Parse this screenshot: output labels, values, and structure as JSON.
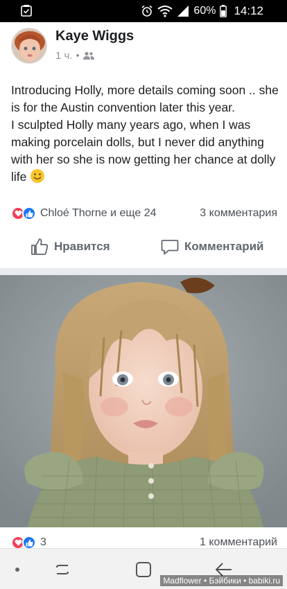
{
  "status_bar": {
    "battery": "60%",
    "time": "14:12"
  },
  "post": {
    "author": "Kaye Wiggs",
    "time_ago": "1 ч.",
    "text_lines": [
      "Introducing Holly, more details coming soon .. she is for the Austin convention later this year.",
      "I sculpted Holly many years ago, when I was making porcelain dolls, but I never did anything with her so she is now getting her chance at dolly life"
    ],
    "reactors": "Chloé Thorne и еще 24",
    "comments": "3 комментария",
    "like_label": "Нравится",
    "comment_label": "Комментарий"
  },
  "photo_footer": {
    "reaction_count": "3",
    "comments": "1 комментарий"
  },
  "watermark": "Madflower • Бэйбики • babiki.ru",
  "colors": {
    "like_blue": "#1877f2",
    "love_red": "#f33e58",
    "meta_gray": "#90949c"
  }
}
